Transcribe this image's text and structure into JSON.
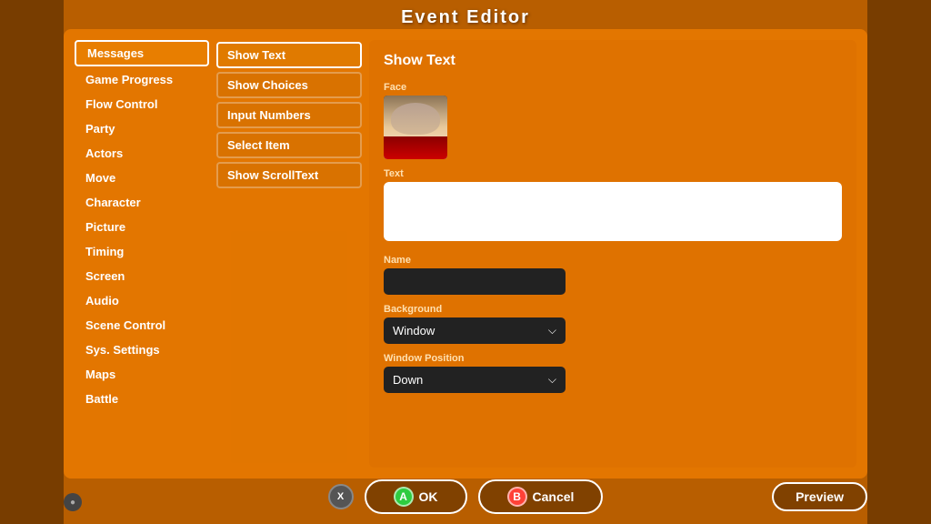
{
  "title": "Event Editor",
  "sidebar": {
    "items": [
      {
        "label": "Messages",
        "active": true
      },
      {
        "label": "Game Progress",
        "active": false
      },
      {
        "label": "Flow Control",
        "active": false
      },
      {
        "label": "Party",
        "active": false
      },
      {
        "label": "Actors",
        "active": false
      },
      {
        "label": "Move",
        "active": false
      },
      {
        "label": "Character",
        "active": false
      },
      {
        "label": "Picture",
        "active": false
      },
      {
        "label": "Timing",
        "active": false
      },
      {
        "label": "Screen",
        "active": false
      },
      {
        "label": "Audio",
        "active": false
      },
      {
        "label": "Scene Control",
        "active": false
      },
      {
        "label": "Sys. Settings",
        "active": false
      },
      {
        "label": "Maps",
        "active": false
      },
      {
        "label": "Battle",
        "active": false
      }
    ]
  },
  "middle_menu": {
    "items": [
      {
        "label": "Show Text",
        "active": true
      },
      {
        "label": "Show Choices",
        "active": false
      },
      {
        "label": "Input Numbers",
        "active": false
      },
      {
        "label": "Select Item",
        "active": false
      },
      {
        "label": "Show ScrollText",
        "active": false
      }
    ]
  },
  "content": {
    "title": "Show Text",
    "face_label": "Face",
    "text_label": "Text",
    "text_value": "",
    "name_label": "Name",
    "name_value": "",
    "background_label": "Background",
    "background_value": "Window",
    "window_position_label": "Window Position",
    "window_position_value": "Down"
  },
  "footer": {
    "ok_label": "OK",
    "cancel_label": "Cancel",
    "preview_label": "Preview",
    "a_badge": "A",
    "b_badge": "B",
    "x_label": "X"
  }
}
